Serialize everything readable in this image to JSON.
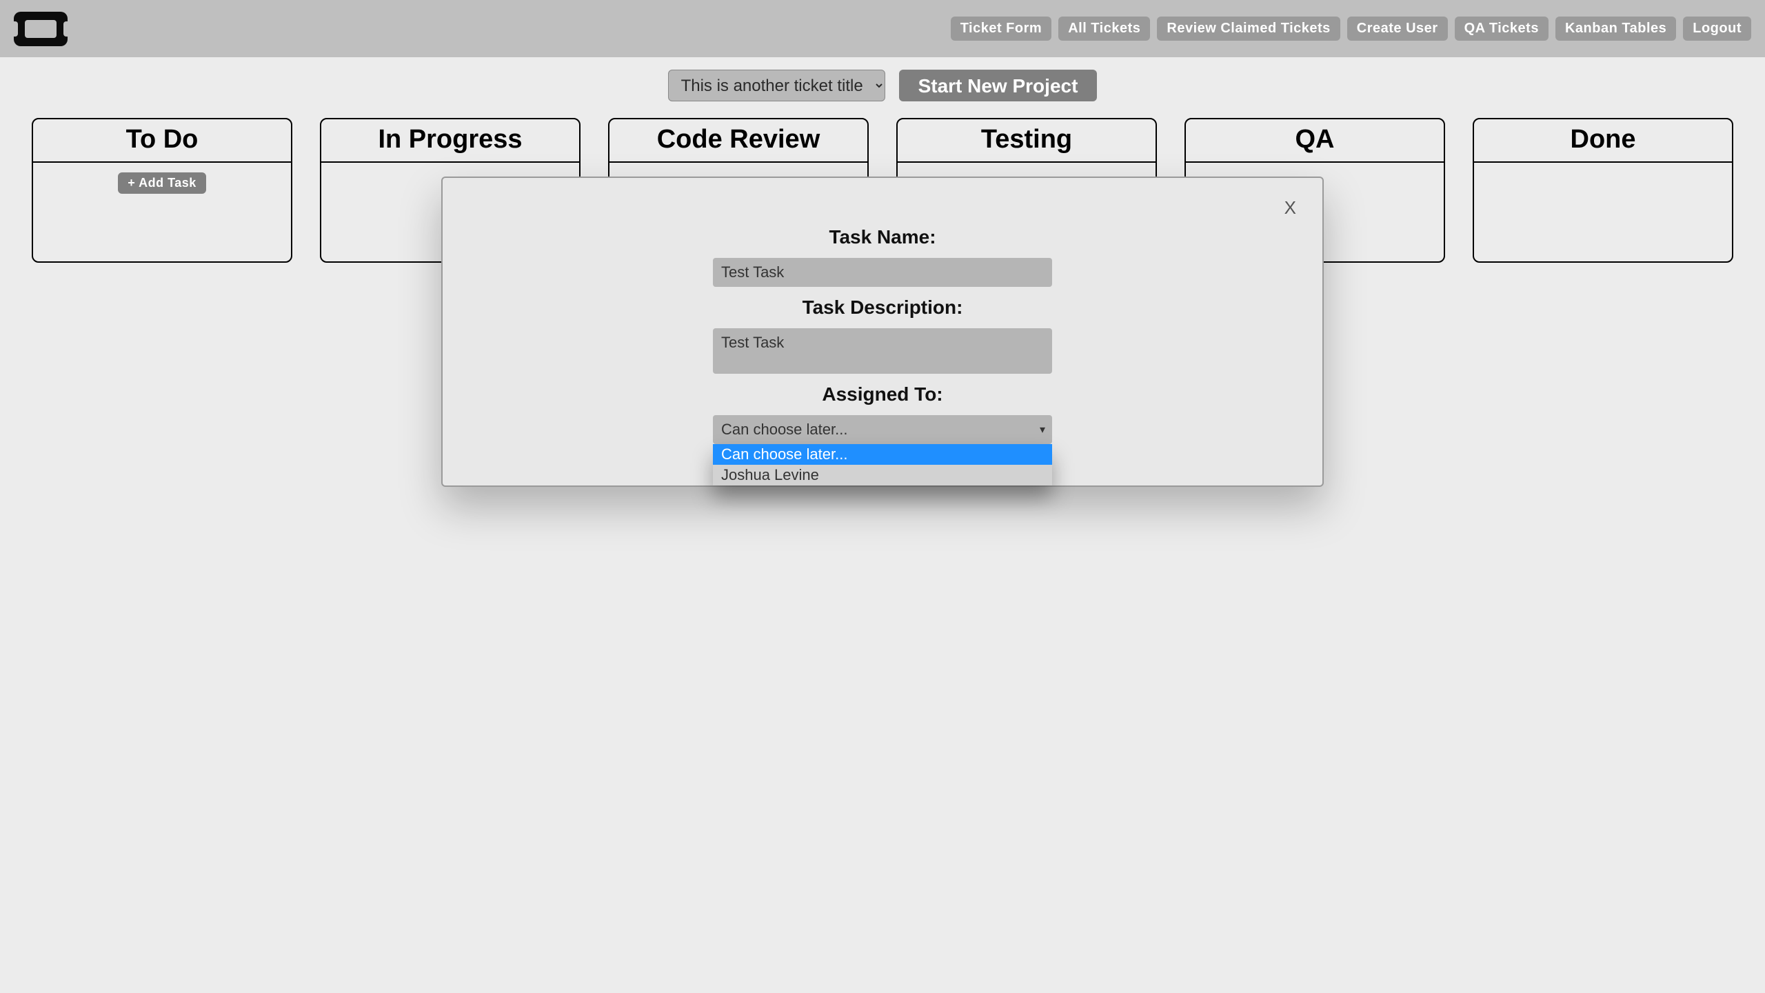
{
  "nav": {
    "items": [
      "Ticket Form",
      "All Tickets",
      "Review Claimed Tickets",
      "Create User",
      "QA Tickets",
      "Kanban Tables",
      "Logout"
    ]
  },
  "toolbar": {
    "project_selected": "This is another ticket title",
    "start_label": "Start New Project"
  },
  "board": {
    "columns": [
      {
        "title": "To Do",
        "has_add": true,
        "add_label": "+ Add Task"
      },
      {
        "title": "In Progress",
        "has_add": false
      },
      {
        "title": "Code Review",
        "has_add": false
      },
      {
        "title": "Testing",
        "has_add": false
      },
      {
        "title": "QA",
        "has_add": false
      },
      {
        "title": "Done",
        "has_add": false
      }
    ]
  },
  "modal": {
    "close": "X",
    "name_label": "Task Name:",
    "name_value": "Test Task",
    "desc_label": "Task Description:",
    "desc_value": "Test Task",
    "assigned_label": "Assigned To:",
    "assigned_selected": "Can choose later...",
    "assigned_options": [
      "Can choose later...",
      "Joshua Levine"
    ]
  }
}
